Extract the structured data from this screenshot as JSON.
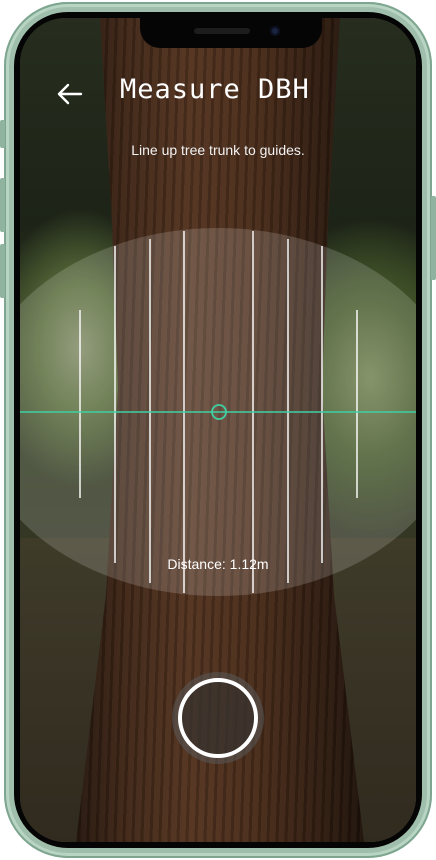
{
  "header": {
    "title": "Measure DBH",
    "back_icon": "arrow-left-icon"
  },
  "instructions": {
    "text": "Line up tree trunk to guides."
  },
  "measurement": {
    "distance_label": "Distance: 1.12m",
    "crosshair_color": "#3fd0a4",
    "guide_line_color": "#ffffff"
  },
  "capture": {
    "icon": "shutter-button-icon"
  },
  "device": {
    "frame_color": "#9fbfac"
  }
}
